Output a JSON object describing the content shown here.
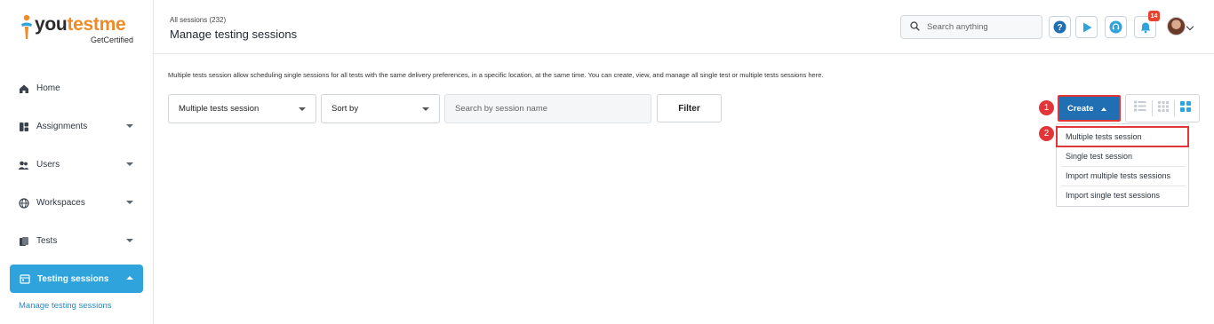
{
  "brand": {
    "name_part1": "you",
    "name_part2": "testme",
    "tagline": "GetCertified"
  },
  "sidebar": {
    "items": [
      {
        "label": "Home",
        "icon": "home-icon"
      },
      {
        "label": "Assignments",
        "icon": "assignments-icon"
      },
      {
        "label": "Users",
        "icon": "users-icon"
      },
      {
        "label": "Workspaces",
        "icon": "globe-icon"
      },
      {
        "label": "Tests",
        "icon": "tests-icon"
      },
      {
        "label": "Testing sessions",
        "icon": "calendar-icon",
        "active": true
      }
    ],
    "sub_link": "Manage testing sessions"
  },
  "header": {
    "breadcrumb": "All sessions (232)",
    "title": "Manage testing sessions",
    "search_placeholder": "Search anything",
    "notifications_count": "14"
  },
  "main": {
    "description": "Multiple tests session allow scheduling single sessions for all tests with the same delivery preferences, in a specific location, at the same time. You can create, view, and manage all single test or multiple tests sessions here.",
    "session_type_select": "Multiple tests session",
    "sort_select": "Sort by",
    "search_placeholder": "Search by session name",
    "filter_label": "Filter",
    "create_label": "Create",
    "create_menu": [
      "Multiple tests session",
      "Single test session",
      "Import multiple tests sessions",
      "Import single test sessions"
    ],
    "step_markers": [
      "1",
      "2"
    ]
  },
  "colors": {
    "accent": "#2ea3dc",
    "primary_button": "#1f6fb2",
    "highlight": "#e0363a",
    "brand_orange": "#f08a24"
  }
}
